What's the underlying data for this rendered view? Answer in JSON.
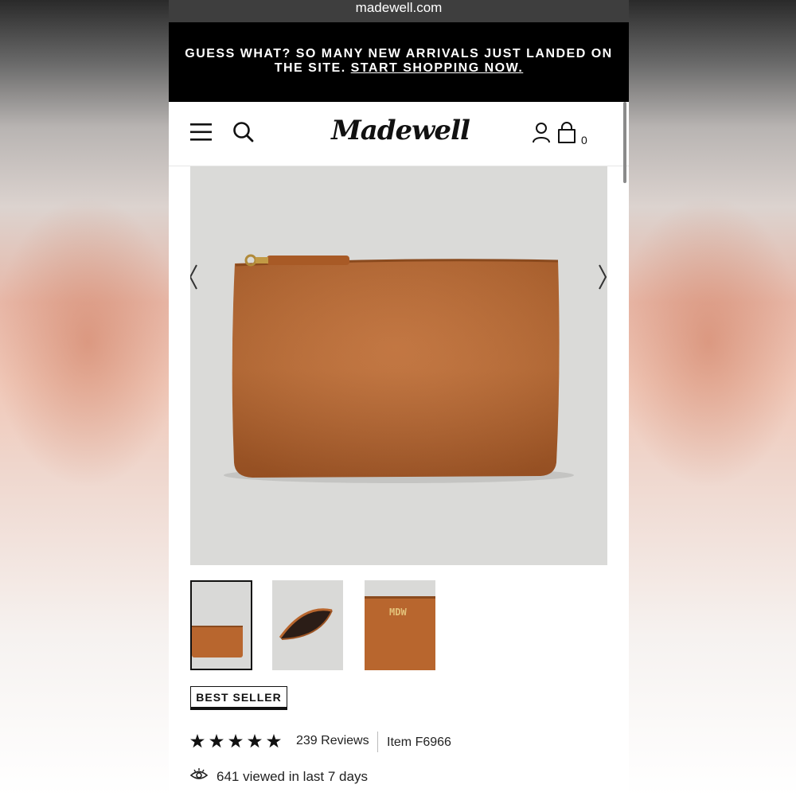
{
  "browser": {
    "url": "madewell.com"
  },
  "promo": {
    "line1": "GUESS WHAT? SO MANY NEW ARRIVALS JUST LANDED ON",
    "line2_prefix": "THE SITE. ",
    "line2_link": "START SHOPPING NOW."
  },
  "header": {
    "brand": "Madewell",
    "cart_count": "0",
    "icons": [
      "menu-icon",
      "search-icon",
      "account-icon",
      "bag-icon"
    ]
  },
  "product": {
    "badge": "BEST SELLER",
    "rating": 5,
    "reviews": "239 Reviews",
    "item": "Item F6966",
    "viewed": "641 viewed in last 7 days",
    "monogram": "MDW",
    "thumbnails": [
      "front",
      "open",
      "monogram"
    ]
  },
  "colors": {
    "leather": "#b8662e",
    "black": "#000000",
    "background": "#dadad8"
  }
}
